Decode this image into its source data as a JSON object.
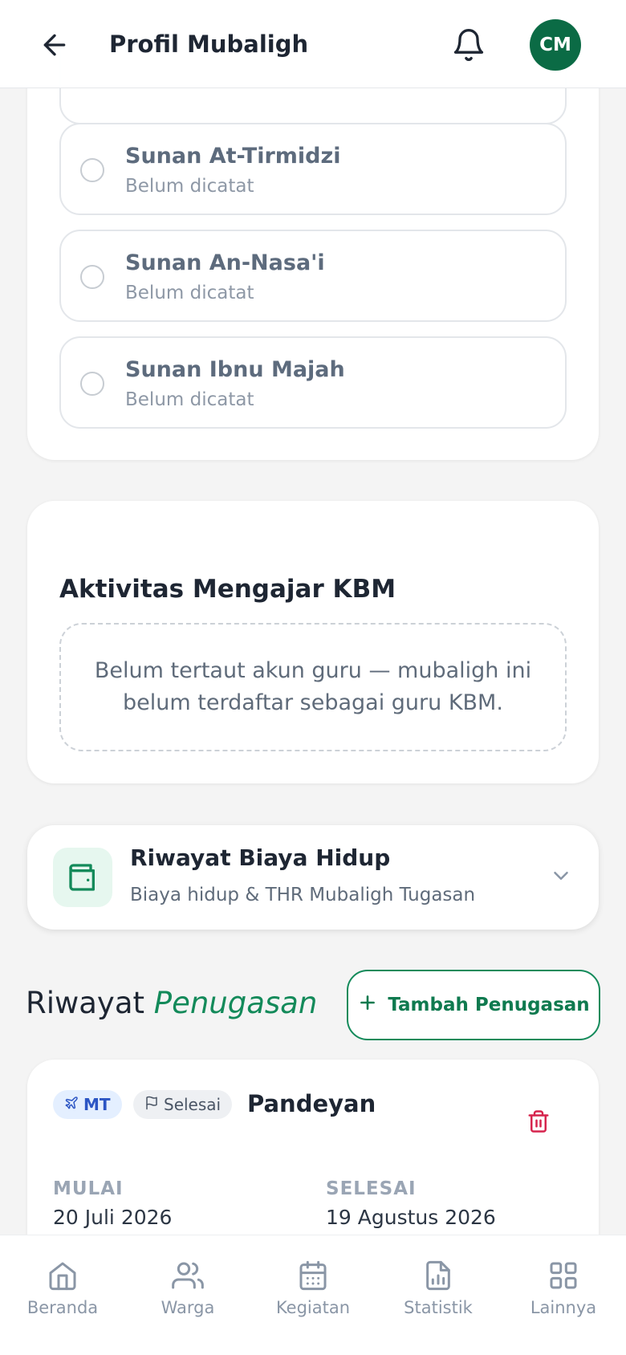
{
  "header": {
    "title": "Profil Mubaligh",
    "avatar_initials": "CM",
    "avatar_color": "#0b6b45"
  },
  "hadith_list": {
    "items": [
      {
        "name": "Sunan At-Tirmidzi",
        "status": "Belum dicatat"
      },
      {
        "name": "Sunan An-Nasa'i",
        "status": "Belum dicatat"
      },
      {
        "name": "Sunan Ibnu Majah",
        "status": "Belum dicatat"
      }
    ]
  },
  "kbm": {
    "title": "Aktivitas Mengajar KBM",
    "empty_message": "Belum tertaut akun guru — mubaligh ini belum terdaftar sebagai guru KBM."
  },
  "biaya_hidup": {
    "title": "Riwayat Biaya Hidup",
    "subtitle": "Biaya hidup & THR Mubaligh Tugasan",
    "icon": "wallet-icon"
  },
  "penugasan": {
    "heading_plain": "Riwayat",
    "heading_accent": "Penugasan",
    "add_button_label": "Tambah Penugasan",
    "items": [
      {
        "type_badge": "MT",
        "status_badge": "Selesai",
        "location": "Pandeyan",
        "start_label": "MULAI",
        "start_date": "20 Juli 2026",
        "end_label": "SELESAI",
        "end_date": "19 Agustus 2026"
      }
    ]
  },
  "bottom_nav": {
    "items": [
      {
        "label": "Beranda",
        "icon": "home-icon"
      },
      {
        "label": "Warga",
        "icon": "users-icon"
      },
      {
        "label": "Kegiatan",
        "icon": "calendar-icon"
      },
      {
        "label": "Statistik",
        "icon": "chart-icon"
      },
      {
        "label": "Lainnya",
        "icon": "grid-icon"
      }
    ]
  },
  "colors": {
    "brand_green": "#138a5a",
    "danger_red": "#d6244d"
  }
}
